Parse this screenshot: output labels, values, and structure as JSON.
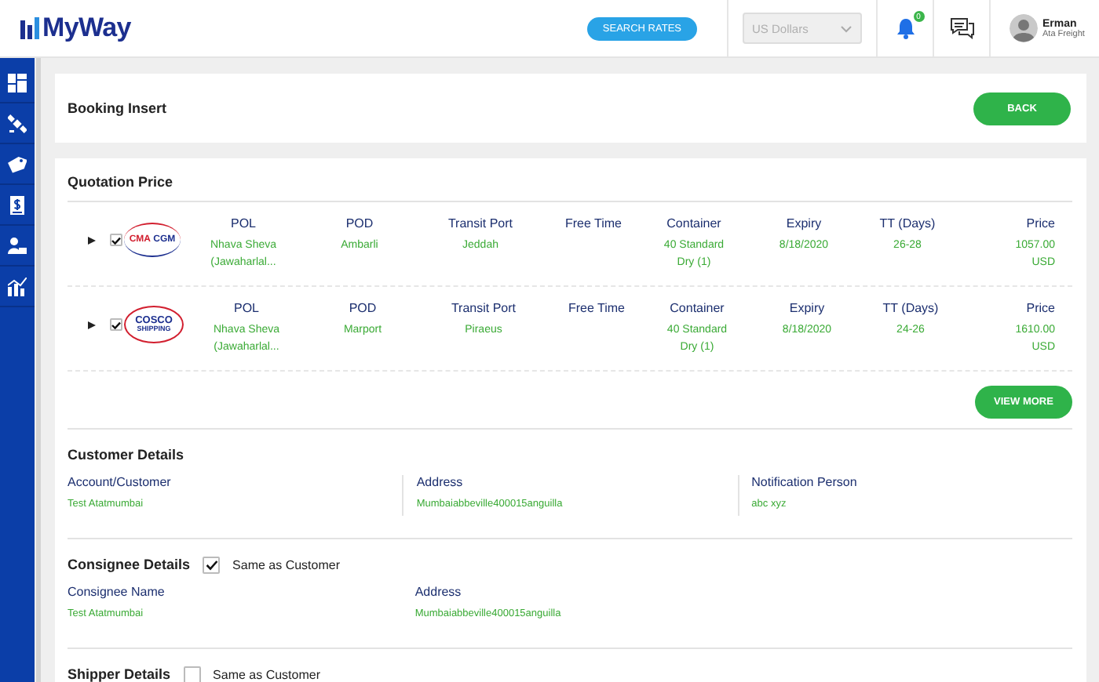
{
  "header": {
    "logo": "MyWay",
    "search_button": "SEARCH RATES",
    "currency": {
      "value": "US Dollars",
      "disabled": true
    },
    "notifications": {
      "badge": "0"
    },
    "user": {
      "name": "Erman",
      "company": "Ata Freight"
    }
  },
  "sidebar": {
    "items": [
      {
        "kind": "dashboard"
      },
      {
        "kind": "satellite"
      },
      {
        "kind": "tag"
      },
      {
        "kind": "invoice"
      },
      {
        "kind": "user-card"
      },
      {
        "kind": "chart"
      }
    ]
  },
  "booking": {
    "title": "Booking Insert",
    "back_button": "BACK"
  },
  "quotation": {
    "title": "Quotation Price",
    "quotes": [
      {
        "expanded": false,
        "checked": true,
        "carrier": {
          "kind": "cma",
          "words": [
            "CMA",
            "CGM"
          ]
        },
        "fields": [
          {
            "label": "POL",
            "value": "Nhava Sheva (Jawaharlal..."
          },
          {
            "label": "POD",
            "value": "Ambarli"
          },
          {
            "label": "Transit Port",
            "value": "Jeddah"
          },
          {
            "label": "Free Time"
          },
          {
            "label": "Container",
            "value": "40 Standard Dry (1)"
          },
          {
            "label": "Expiry",
            "value": "8/18/2020"
          },
          {
            "label": "TT (Days)",
            "value": "26-28"
          },
          {
            "label": "Price",
            "value": "1057.00 USD"
          }
        ]
      },
      {
        "expanded": false,
        "checked": true,
        "carrier": {
          "kind": "cosco",
          "words": [
            "COSCO",
            "SHIPPING"
          ]
        },
        "fields": [
          {
            "label": "POL",
            "value": "Nhava Sheva (Jawaharlal..."
          },
          {
            "label": "POD",
            "value": "Marport"
          },
          {
            "label": "Transit Port",
            "value": "Piraeus"
          },
          {
            "label": "Free Time"
          },
          {
            "label": "Container",
            "value": "40 Standard Dry (1)"
          },
          {
            "label": "Expiry",
            "value": "8/18/2020"
          },
          {
            "label": "TT (Days)",
            "value": "24-26"
          },
          {
            "label": "Price",
            "value": "1610.00 USD"
          }
        ]
      }
    ],
    "view_more_button": "VIEW MORE"
  },
  "customer_details": {
    "title": "Customer Details",
    "fields": [
      {
        "label": "Account/Customer",
        "value": "Test Atatmumbai"
      },
      {
        "label": "Address",
        "value": "Mumbaiabbeville400015anguilla"
      },
      {
        "label": "Notification Person",
        "value": "abc xyz"
      }
    ]
  },
  "consignee_details": {
    "title": "Consignee Details",
    "same_as_customer": {
      "label": "Same as Customer",
      "checked": true
    },
    "fields": [
      {
        "label": "Consignee Name",
        "value": "Test Atatmumbai"
      },
      {
        "label": "Address",
        "value": "Mumbaiabbeville400015anguilla"
      }
    ]
  },
  "shipper_details": {
    "title": "Shipper Details",
    "same_as_customer": {
      "label": "Same as Customer",
      "checked": false
    }
  }
}
